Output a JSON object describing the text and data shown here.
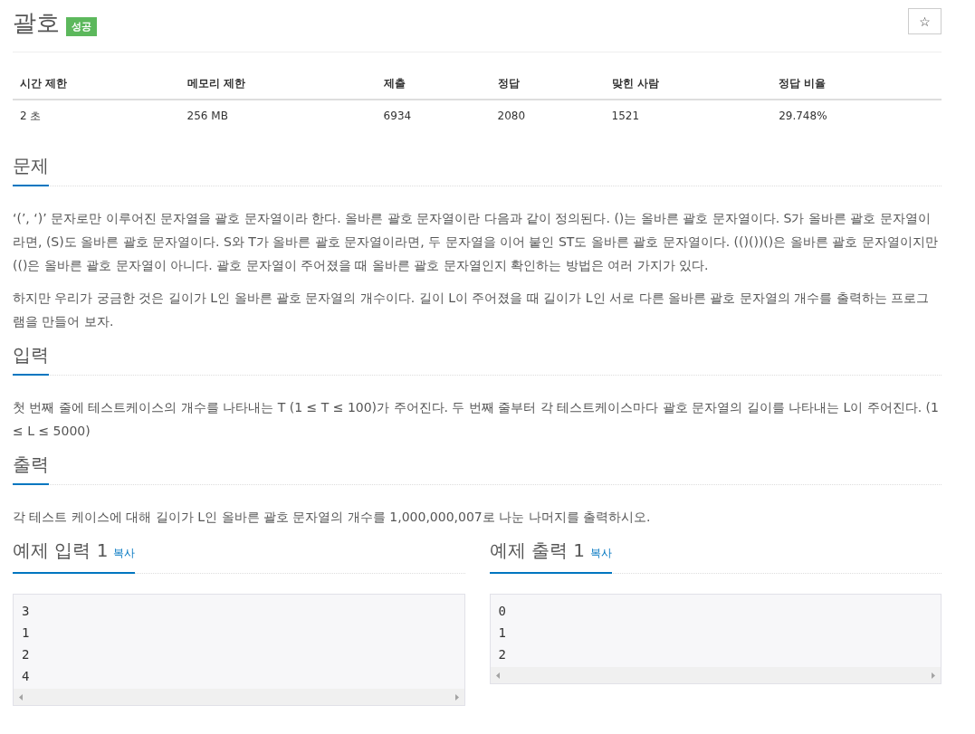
{
  "problem": {
    "title": "괄호",
    "badge": "성공",
    "star": "☆"
  },
  "stats_table": {
    "columns": [
      "시간 제한",
      "메모리 제한",
      "제출",
      "정답",
      "맞힌 사람",
      "정답 비율"
    ],
    "rows": [
      [
        "2 초",
        "256 MB",
        "6934",
        "2080",
        "1521",
        "29.748%"
      ]
    ]
  },
  "sections": [
    {
      "heading": "문제",
      "paragraphs": [
        "‘(’, ‘)’ 문자로만 이루어진 문자열을 괄호 문자열이라 한다. 올바른 괄호 문자열이란 다음과 같이 정의된다. ()는 올바른 괄호 문자열이다. S가 올바른 괄호 문자열이라면, (S)도 올바른 괄호 문자열이다. S와 T가 올바른 괄호 문자열이라면, 두 문자열을 이어 붙인 ST도 올바른 괄호 문자열이다. (()())()은 올바른 괄호 문자열이지만 (()은 올바른 괄호 문자열이 아니다. 괄호 문자열이 주어졌을 때 올바른 괄호 문자열인지 확인하는 방법은 여러 가지가 있다.",
        "하지만 우리가 궁금한 것은 길이가 L인 올바른 괄호 문자열의 개수이다. 길이 L이 주어졌을 때 길이가 L인 서로 다른 올바른 괄호 문자열의 개수를 출력하는 프로그램을 만들어 보자."
      ]
    },
    {
      "heading": "입력",
      "paragraphs": [
        "첫 번째 줄에 테스트케이스의 개수를 나타내는 T (1 ≤ T ≤ 100)가 주어진다. 두 번째 줄부터 각 테스트케이스마다 괄호 문자열의 길이를 나타내는 L이 주어진다. (1 ≤ L ≤ 5000)"
      ]
    },
    {
      "heading": "출력",
      "paragraphs": [
        "각 테스트 케이스에 대해 길이가 L인 올바른 괄호 문자열의 개수를 1,000,000,007로 나눈 나머지를 출력하시오."
      ]
    }
  ],
  "samples": [
    {
      "heading": "예제 입력 1",
      "copy_label": "복사",
      "text": "3\n1\n2\n4"
    },
    {
      "heading": "예제 출력 1",
      "copy_label": "복사",
      "text": "0\n1\n2"
    }
  ]
}
